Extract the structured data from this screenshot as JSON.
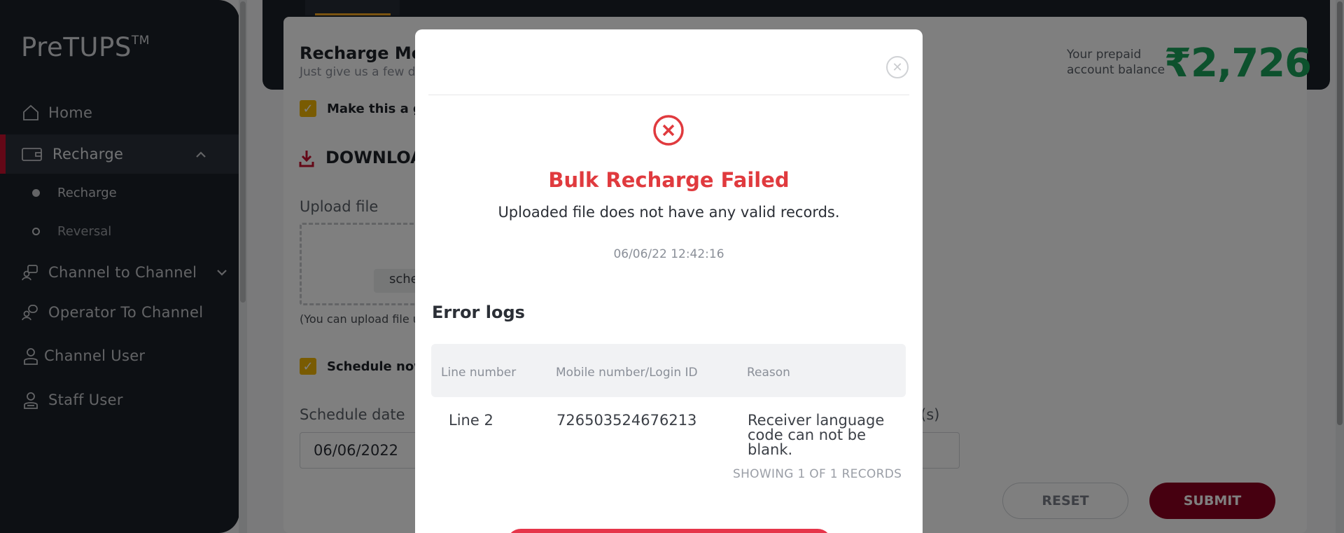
{
  "app": {
    "brand": "PreTUPS",
    "brand_tm": "TM"
  },
  "sidebar": {
    "items": [
      {
        "label": "Home",
        "icon": "home-icon"
      },
      {
        "label": "Recharge",
        "icon": "wallet-icon",
        "active": true,
        "expanded": true
      },
      {
        "label": "Channel to Channel",
        "icon": "channel-transfer-icon"
      },
      {
        "label": "Operator To Channel",
        "icon": "operator-transfer-icon"
      },
      {
        "label": "Channel User",
        "icon": "user-icon"
      },
      {
        "label": "Staff User",
        "icon": "staff-user-icon"
      }
    ],
    "sub_items": [
      {
        "label": "Recharge",
        "selected": true
      },
      {
        "label": "Reversal",
        "selected": false
      }
    ]
  },
  "page": {
    "title": "Recharge Mob",
    "subtitle": "Just give us a few d",
    "balance_label_line1": "Your prepaid",
    "balance_label_line2": "account balance",
    "balance_value": "₹2,726",
    "gift_label": "Make this a gif",
    "download_label": "DOWNLOAD",
    "upload_label": "Upload file",
    "dropzone_text": "sche",
    "upload_hint": "(You can upload file u",
    "schedule_now_label": "Schedule now",
    "schedule_date_label": "Schedule date",
    "schedule_date_value": "06/06/2022",
    "right_field_label": "(s)",
    "reset_label": "RESET",
    "submit_label": "SUBMIT"
  },
  "modal": {
    "title": "Bulk Recharge Failed",
    "message": "Uploaded file does not have any valid records.",
    "timestamp": "06/06/22 12:42:16",
    "error_logs_heading": "Error logs",
    "columns": [
      "Line number",
      "Mobile number/Login ID",
      "Reason"
    ],
    "rows": [
      {
        "line": "Line 2",
        "mobile": "726503524676213",
        "reason_lines": [
          "Receiver language",
          "code can not be",
          "blank."
        ]
      }
    ],
    "records_text": "SHOWING 1 OF 1 RECORDS"
  },
  "colors": {
    "sidebar_bg": "#1b2029",
    "accent_red": "#c8102e",
    "error_red": "#e03a3e",
    "balance_green": "#1aa35a",
    "checkbox_yellow": "#f2b705",
    "submit_bg": "#8d0020"
  }
}
